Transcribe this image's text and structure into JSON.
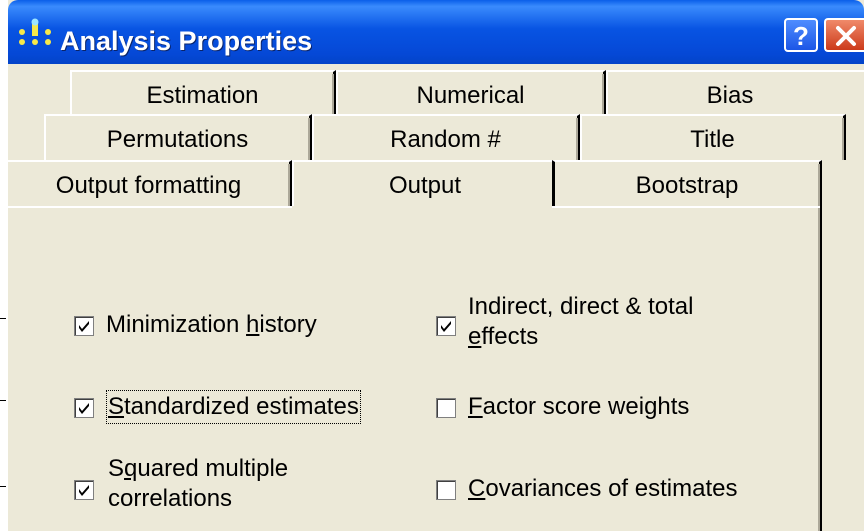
{
  "window": {
    "title": "Analysis Properties",
    "help_button": "?",
    "close_button": "X"
  },
  "tabs": {
    "row1": [
      "Estimation",
      "Numerical",
      "Bias"
    ],
    "row2": [
      "Permutations",
      "Random #",
      "Title"
    ],
    "row3": [
      "Output formatting",
      "Output",
      "Bootstrap"
    ],
    "active": "Output"
  },
  "checkboxes": [
    {
      "label_pre": "Minimization ",
      "label_ul": "h",
      "label_post": "istory",
      "checked": true
    },
    {
      "label_pre": "",
      "label_ul": "S",
      "label_post": "tandardized estimates",
      "checked": true
    },
    {
      "label_pre": "S",
      "label_ul": "q",
      "label_post": "uared multiple",
      "label_line2": "correlations",
      "checked": true
    },
    {
      "label_line1": "Indirect, direct & total",
      "label_pre": "",
      "label_ul": "e",
      "label_post": "ffects",
      "checked": true
    },
    {
      "label_pre": "",
      "label_ul": "F",
      "label_post": "actor score weights",
      "checked": false
    },
    {
      "label_pre": "",
      "label_ul": "C",
      "label_post": "ovariances of estimates",
      "checked": false
    }
  ],
  "colors": {
    "titlebar": "#0548d6",
    "face": "#ece9d8",
    "close": "#cc3a1a"
  }
}
